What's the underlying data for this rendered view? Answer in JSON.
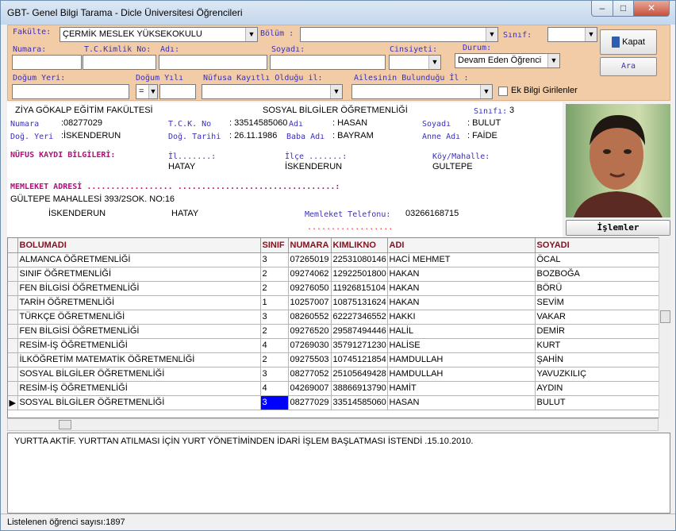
{
  "window": {
    "title": "GBT- Genel Bilgi Tarama - Dicle Üniversitesi Öğrencileri",
    "min": "–",
    "max": "□",
    "close": "✕"
  },
  "filter": {
    "fakulte_label": "Fakülte:",
    "fakulte_value": "ÇERMİK  MESLEK YÜKSEKOKULU",
    "bolum_label": "Bölüm :",
    "bolum_value": "",
    "sinif_label": "Sınıf:",
    "sinif_value": "",
    "numara_label": "Numara:",
    "numara_value": "",
    "tckimlik_label": "T.C.Kimlik No:",
    "tckimlik_value": "",
    "adi_label": "Adı:",
    "adi_value": "",
    "soyadi_label": "Soyadı:",
    "soyadi_value": "",
    "cinsiyet_label": "Cinsiyeti:",
    "cinsiyet_value": "",
    "durum_label": "Durum:",
    "durum_value": "Devam Eden Öğrenci",
    "dogumyeri_label": "Doğum Yeri:",
    "dogumyeri_value": "",
    "dogumyili_label": "Doğum Yılı",
    "dogumyili_op": "=",
    "dogumyili_value": "",
    "nufus_label": "Nüfusa Kayıtlı Olduğu il:",
    "nufus_value": "",
    "aile_label": "Ailesinin Bulunduğu İl :",
    "aile_value": "",
    "ekbilgi_label": "Ek Bilgi Girilenler",
    "kapat_label": "Kapat",
    "ara_label": "Ara"
  },
  "info": {
    "fakulte": "ZİYA GÖKALP EĞİTİM FAKÜLTESİ",
    "bolum": "SOSYAL BİLGİLER ÖĞRETMENLİĞİ",
    "sinif_label": "Sınıfı:",
    "sinif_value": "3",
    "numara_label": "Numara",
    "numara_value": ":08277029",
    "tck_label": "T.C.K. No",
    "tck_value": ": 33514585060",
    "adi_label": "Adı",
    "adi_value": ": HASAN",
    "soyadi_label": "Soyadı",
    "soyadi_value": ": BULUT",
    "dogyeri_label": "Doğ. Yeri",
    "dogyeri_value": ":İSKENDERUN",
    "dogtarihi_label": "Doğ. Tarihi",
    "dogtarihi_value": ": 26.11.1986",
    "babaadi_label": "Baba Adı",
    "babaadi_value": ": BAYRAM",
    "anneadi_label": "Anne Adı",
    "anneadi_value": ": FAİDE",
    "nufus_header": "NÜFUS KAYDI BİLGİLERİ:",
    "il_label": "İl.......:",
    "il_value": "HATAY",
    "ilce_label": "İlçe .......:",
    "ilce_value": "İSKENDERUN",
    "koy_label": "Köy/Mahalle:",
    "koy_value": "GULTEPE",
    "memleket_header": "MEMLEKET ADRESİ  ..................  .................................:",
    "adres_line": "GÜLTEPE  MAHALLESİ 393/2SOK. NO:16",
    "adres_ilce": "İSKENDERUN",
    "adres_il": "HATAY",
    "telefon_label": "Memleket Telefonu:",
    "telefon_value": "03266168715",
    "dots": "..................",
    "islemler_label": "İşlemler"
  },
  "grid": {
    "columns": [
      "BOLUMADI",
      "SINIF",
      "NUMARA",
      "KIMLIKNO",
      "ADI",
      "SOYADI"
    ],
    "rows": [
      [
        "ALMANCA ÖĞRETMENLİĞİ",
        "3",
        "07265019",
        "22531080146",
        "HACİ MEHMET",
        "ÖCAL"
      ],
      [
        "SINIF ÖĞRETMENLİĞİ",
        "2",
        "09274062",
        "12922501800",
        "HAKAN",
        "BOZBOĞA"
      ],
      [
        "FEN BİLGİSİ ÖĞRETMENLİĞİ",
        "2",
        "09276050",
        "11926815104",
        "HAKAN",
        "BÖRÜ"
      ],
      [
        "TARİH ÖĞRETMENLİĞİ",
        "1",
        "10257007",
        "10875131624",
        "HAKAN",
        "SEVİM"
      ],
      [
        "TÜRKÇE ÖĞRETMENLİĞİ",
        "3",
        "08260552",
        "62227346552",
        "HAKKI",
        "VAKAR"
      ],
      [
        "FEN BİLGİSİ ÖĞRETMENLİĞİ",
        "2",
        "09276520",
        "29587494446",
        "HALİL",
        "DEMİR"
      ],
      [
        "RESİM-İŞ ÖĞRETMENLİĞİ",
        "4",
        "07269030",
        "35791271230",
        "HALİSE",
        "KURT"
      ],
      [
        "İLKÖĞRETİM MATEMATİK ÖĞRETMENLİĞİ",
        "2",
        "09275503",
        "10745121854",
        "HAMDULLAH",
        "ŞAHİN"
      ],
      [
        "SOSYAL BİLGİLER ÖĞRETMENLİĞİ",
        "3",
        "08277052",
        "25105649428",
        "HAMDULLAH",
        "YAVUZKILIÇ"
      ],
      [
        "RESİM-İŞ ÖĞRETMENLİĞİ",
        "4",
        "04269007",
        "38866913790",
        "HAMİT",
        "AYDIN"
      ],
      [
        "SOSYAL BİLGİLER ÖĞRETMENLİĞİ",
        "3",
        "08277029",
        "33514585060",
        "HASAN",
        "BULUT"
      ]
    ],
    "selected_row": 10
  },
  "memo": "YURTTA AKTİF. YURTTAN ATILMASI İÇİN YURT YÖNETİMİNDEN İDARİ İŞLEM BAŞLATMASI İSTENDİ .15.10.2010.",
  "status": "Listelenen öğrenci sayısı:1897"
}
